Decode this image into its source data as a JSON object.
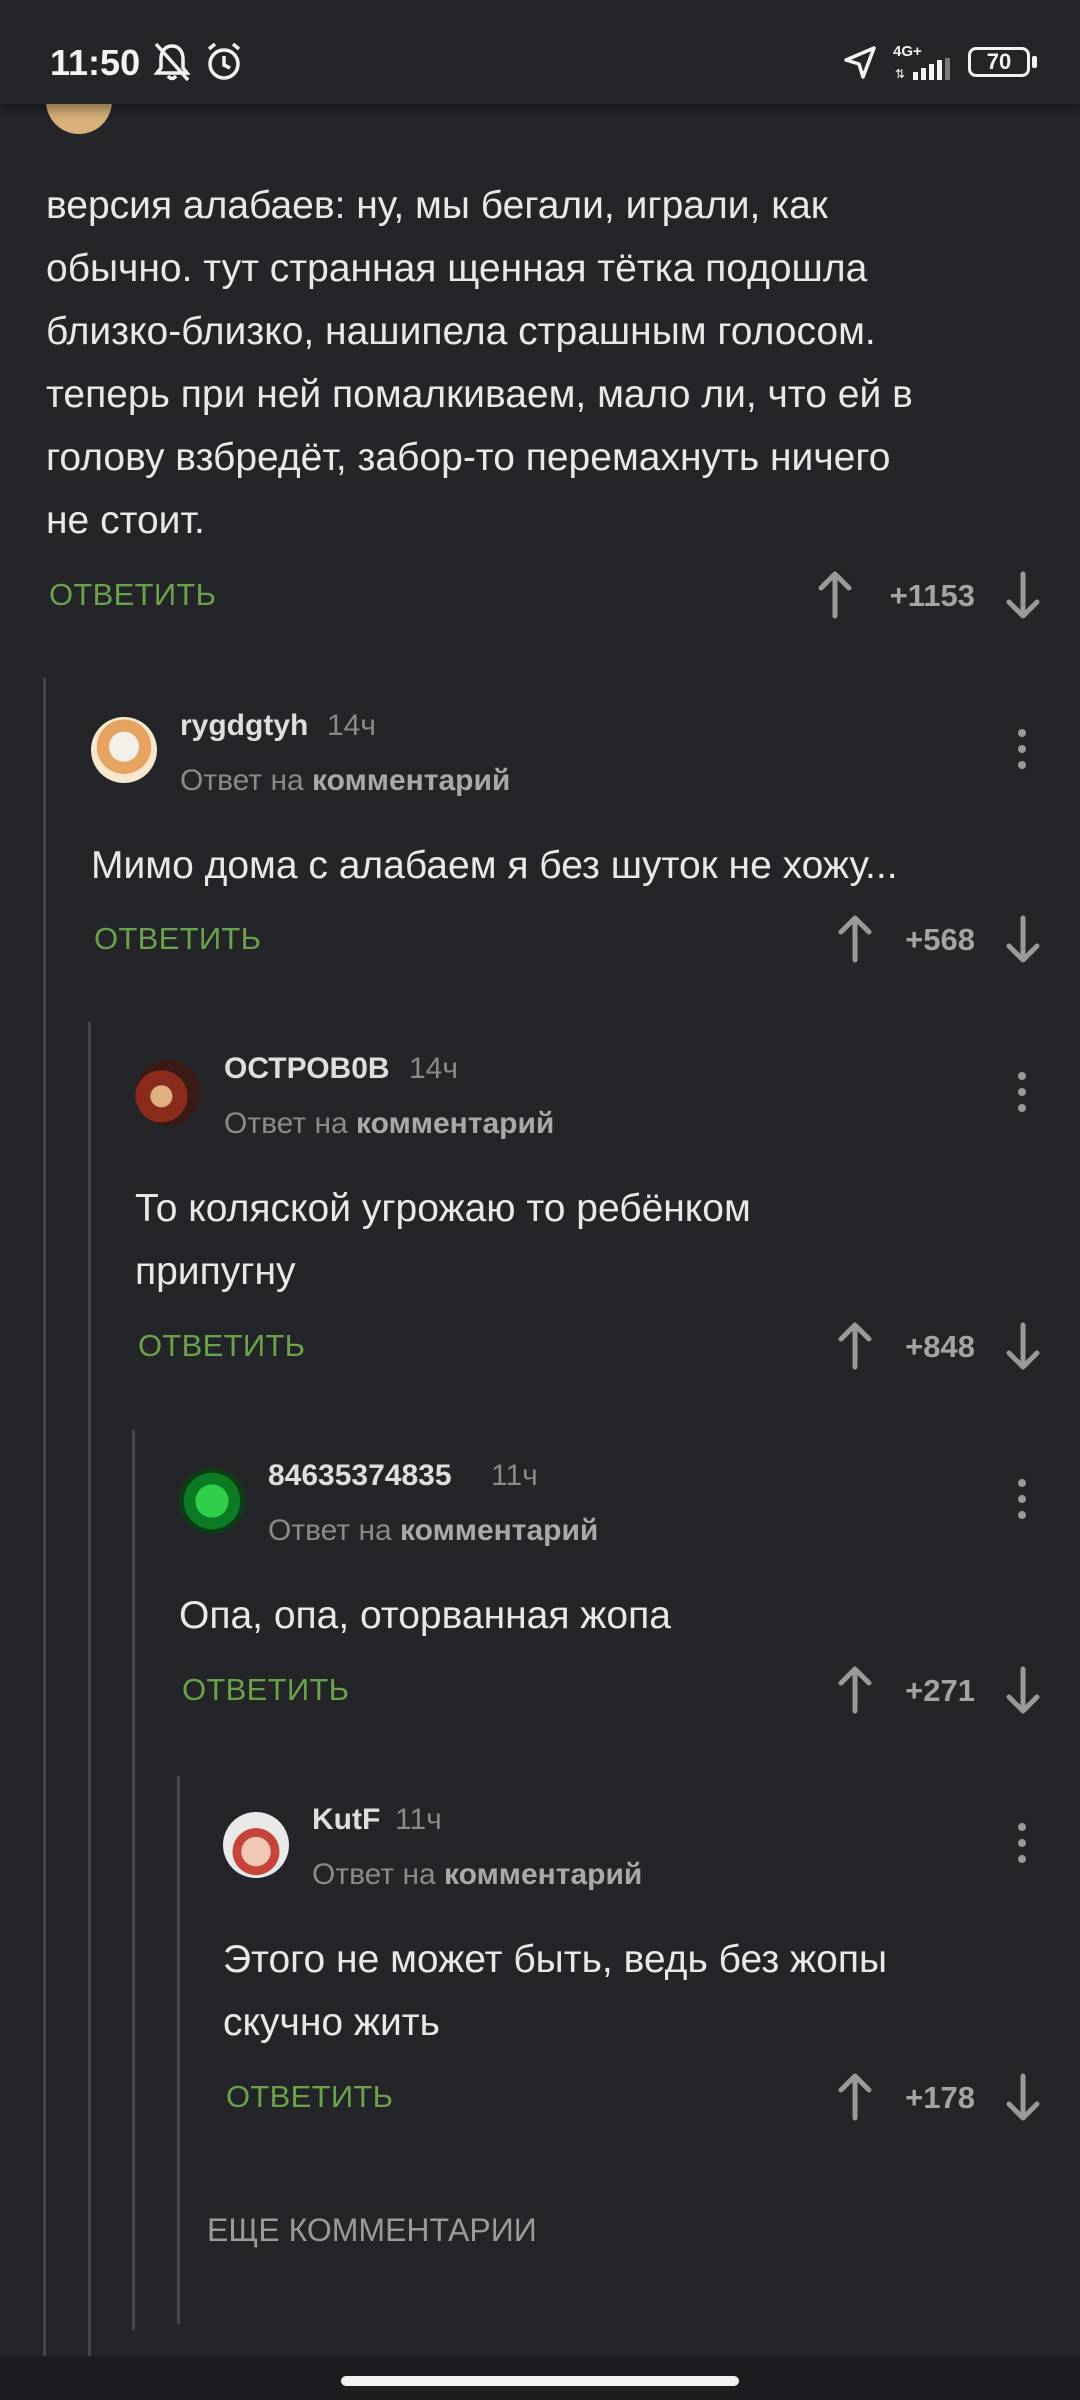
{
  "status_bar": {
    "time": "11:50",
    "network": "4G+",
    "battery": "70",
    "icons": [
      "bell-off-icon",
      "alarm-icon",
      "location-arrow-icon",
      "signal-icon",
      "battery-icon"
    ]
  },
  "colors": {
    "background": "#232529",
    "reply_link": "#6aa14a",
    "text": "#e8e8e8",
    "muted": "#8a8a8a"
  },
  "top_comment": {
    "text_lines": [
      "версия алабаев: ну, мы бегали, играли, как",
      "обычно. тут странная щенная тётка подошла",
      "близко-близко, нашипела страшным голосом.",
      "теперь при ней помалкиваем, мало ли, что ей в",
      "голову взбредёт, забор-то перемахнуть ничего",
      "не стоит."
    ],
    "reply_label": "ОТВЕТИТЬ",
    "votes": "+1153"
  },
  "comments": [
    {
      "username": "rygdgtyh",
      "time": "14ч",
      "reply_prefix": "Ответ на",
      "reply_target": "комментарий",
      "text_lines": [
        "Мимо дома с алабаем я без шуток не хожу..."
      ],
      "reply_label": "ОТВЕТИТЬ",
      "votes": "+568"
    },
    {
      "username": "ОСТРОВ0В",
      "time": "14ч",
      "reply_prefix": "Ответ на",
      "reply_target": "комментарий",
      "text_lines": [
        "То коляской угрожаю то ребёнком",
        "припугну"
      ],
      "reply_label": "ОТВЕТИТЬ",
      "votes": "+848"
    },
    {
      "username": "84635374835",
      "time": "11ч",
      "reply_prefix": "Ответ на",
      "reply_target": "комментарий",
      "text_lines": [
        "Опа, опа, оторванная жопа"
      ],
      "reply_label": "ОТВЕТИТЬ",
      "votes": "+271"
    },
    {
      "username": "KutF",
      "time": "11ч",
      "reply_prefix": "Ответ на",
      "reply_target": "комментарий",
      "text_lines": [
        "Этого не может быть, ведь без жопы",
        "скучно жить"
      ],
      "reply_label": "ОТВЕТИТЬ",
      "votes": "+178"
    }
  ],
  "more_comments_label": "ЕЩЕ КОММЕНТАРИИ"
}
